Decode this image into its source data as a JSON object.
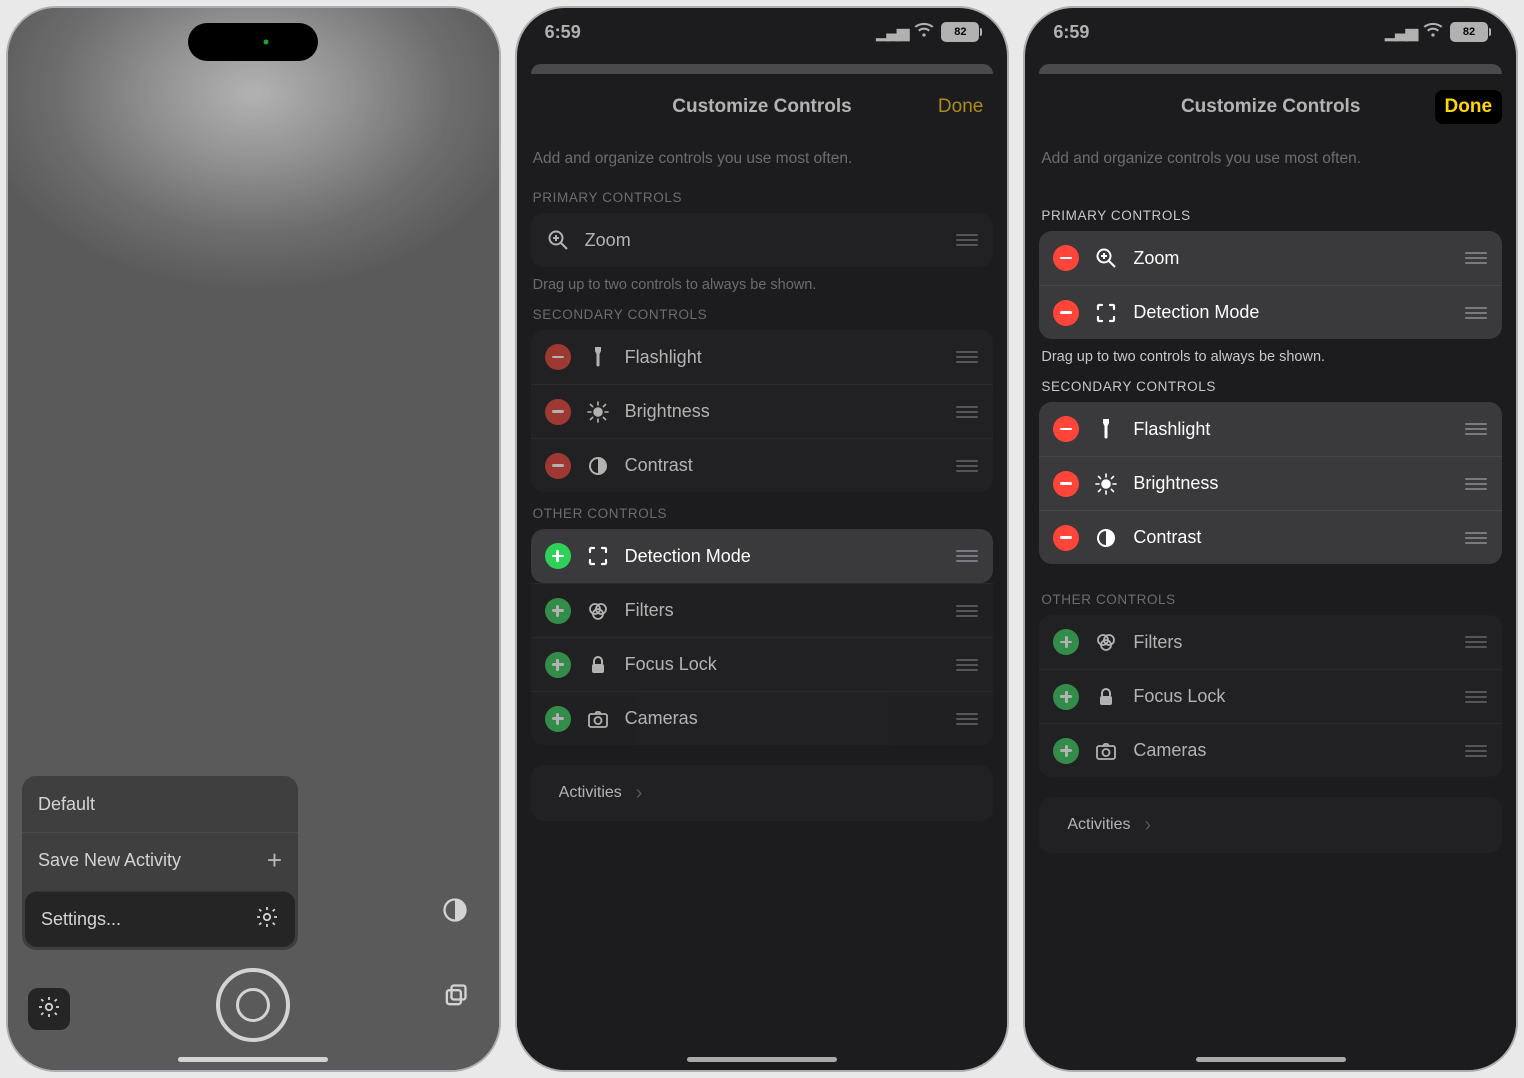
{
  "status": {
    "time": "6:59",
    "battery": "82"
  },
  "phone1": {
    "menu": {
      "default": "Default",
      "save": "Save New Activity",
      "settings": "Settings..."
    }
  },
  "sheet": {
    "title": "Customize Controls",
    "done": "Done",
    "subtitle": "Add and organize controls you use most often.",
    "primary_h": "PRIMARY CONTROLS",
    "secondary_h": "SECONDARY CONTROLS",
    "other_h": "OTHER CONTROLS",
    "hint": "Drag up to two controls to always be shown.",
    "activities": "Activities",
    "zoom": "Zoom",
    "detection": "Detection Mode",
    "flashlight": "Flashlight",
    "brightness": "Brightness",
    "contrast": "Contrast",
    "filters": "Filters",
    "focus": "Focus Lock",
    "cameras": "Cameras"
  },
  "chart_data": null
}
